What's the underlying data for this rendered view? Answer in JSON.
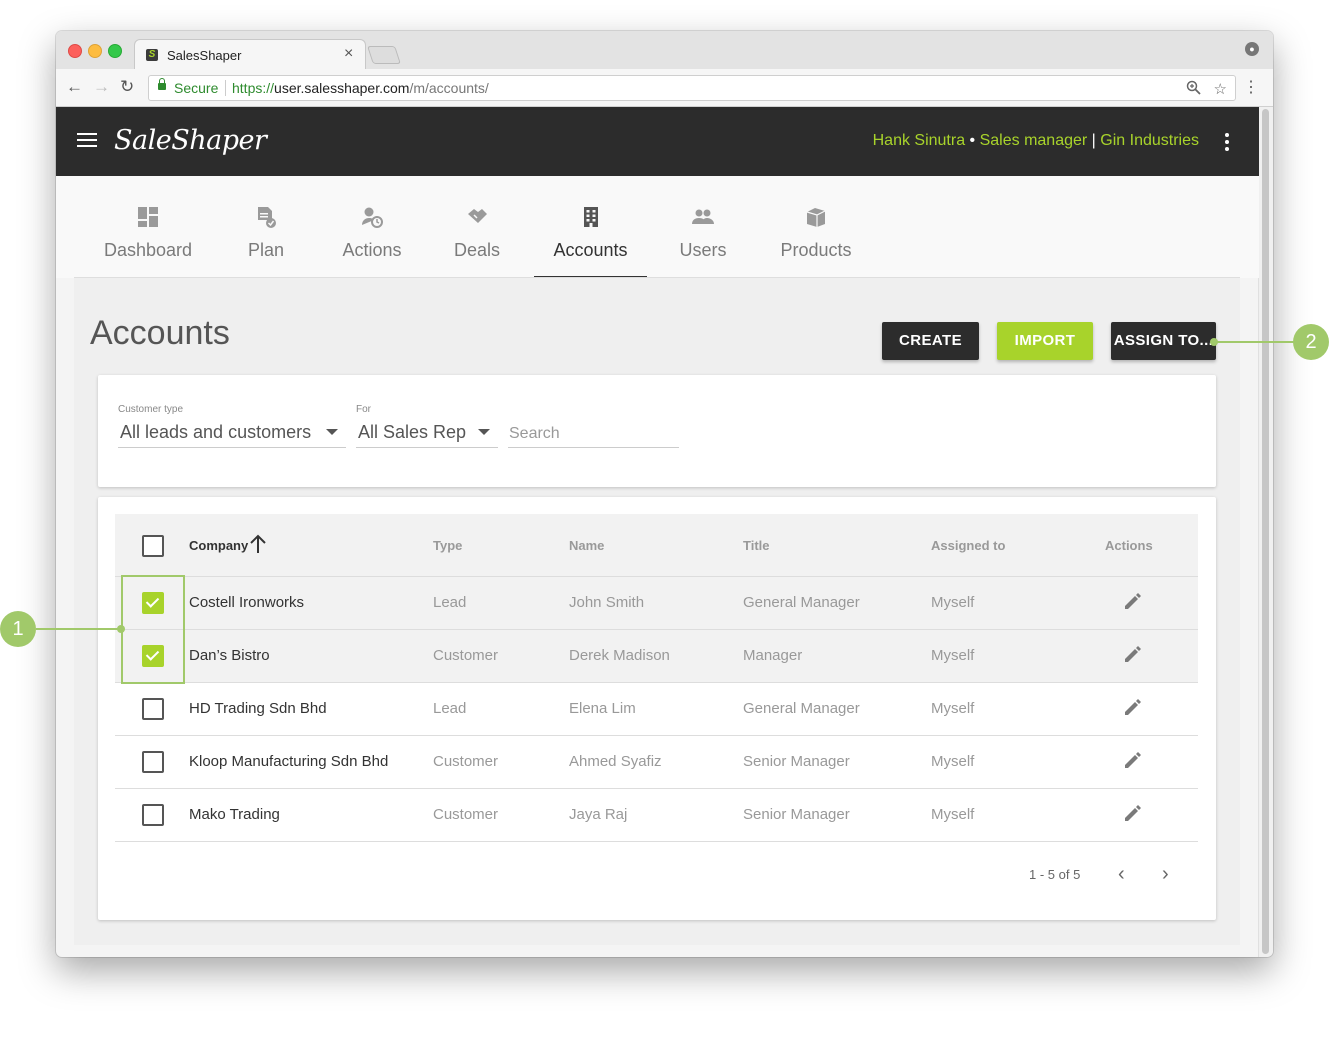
{
  "browser": {
    "tab_title": "SalesShaper",
    "tab_close": "×",
    "secure_label": "Secure",
    "url_scheme": "https://",
    "url_host": "user.salesshaper.com",
    "url_path": "/m/accounts/"
  },
  "header": {
    "logo_text": "SaleShaper",
    "user_name": "Hank Sinutra",
    "separator": " • ",
    "role": "Sales manager",
    "divider": " | ",
    "company": "Gin Industries"
  },
  "nav": {
    "items": [
      {
        "label": "Dashboard",
        "icon": "dashboard-icon"
      },
      {
        "label": "Plan",
        "icon": "plan-icon"
      },
      {
        "label": "Actions",
        "icon": "actions-icon"
      },
      {
        "label": "Deals",
        "icon": "deals-icon"
      },
      {
        "label": "Accounts",
        "icon": "accounts-icon",
        "active": true
      },
      {
        "label": "Users",
        "icon": "users-icon"
      },
      {
        "label": "Products",
        "icon": "products-icon"
      }
    ]
  },
  "page": {
    "title": "Accounts",
    "create_label": "CREATE",
    "import_label": "IMPORT",
    "assign_label": "ASSIGN TO..."
  },
  "filters": {
    "customer_type_label": "Customer type",
    "customer_type_value": "All leads and customers",
    "for_label": "For",
    "for_value": "All Sales Rep",
    "search_placeholder": "Search"
  },
  "table": {
    "columns": [
      "Company",
      "Type",
      "Name",
      "Title",
      "Assigned to",
      "Actions"
    ],
    "sort_icon": "arrow-up-icon",
    "rows": [
      {
        "company": "Costell Ironworks",
        "type": "Lead",
        "name": "John Smith",
        "title": "General Manager",
        "assigned": "Myself",
        "checked": true
      },
      {
        "company": "Dan’s Bistro",
        "type": "Customer",
        "name": "Derek Madison",
        "title": "Manager",
        "assigned": "Myself",
        "checked": true
      },
      {
        "company": "HD Trading Sdn Bhd",
        "type": "Lead",
        "name": "Elena Lim",
        "title": "General Manager",
        "assigned": "Myself",
        "checked": false
      },
      {
        "company": "Kloop Manufacturing Sdn Bhd",
        "type": "Customer",
        "name": "Ahmed Syafiz",
        "title": "Senior Manager",
        "assigned": "Myself",
        "checked": false
      },
      {
        "company": "Mako Trading",
        "type": "Customer",
        "name": "Jaya Raj",
        "title": "Senior Manager",
        "assigned": "Myself",
        "checked": false
      }
    ],
    "pagination": "1 - 5 of 5",
    "prev": "‹",
    "next": "›"
  },
  "annotations": {
    "callout_1": "1",
    "callout_2": "2"
  },
  "colors": {
    "accent": "#a8d32b",
    "header_bg": "#2c2c2c",
    "callout": "#a1c96a"
  }
}
